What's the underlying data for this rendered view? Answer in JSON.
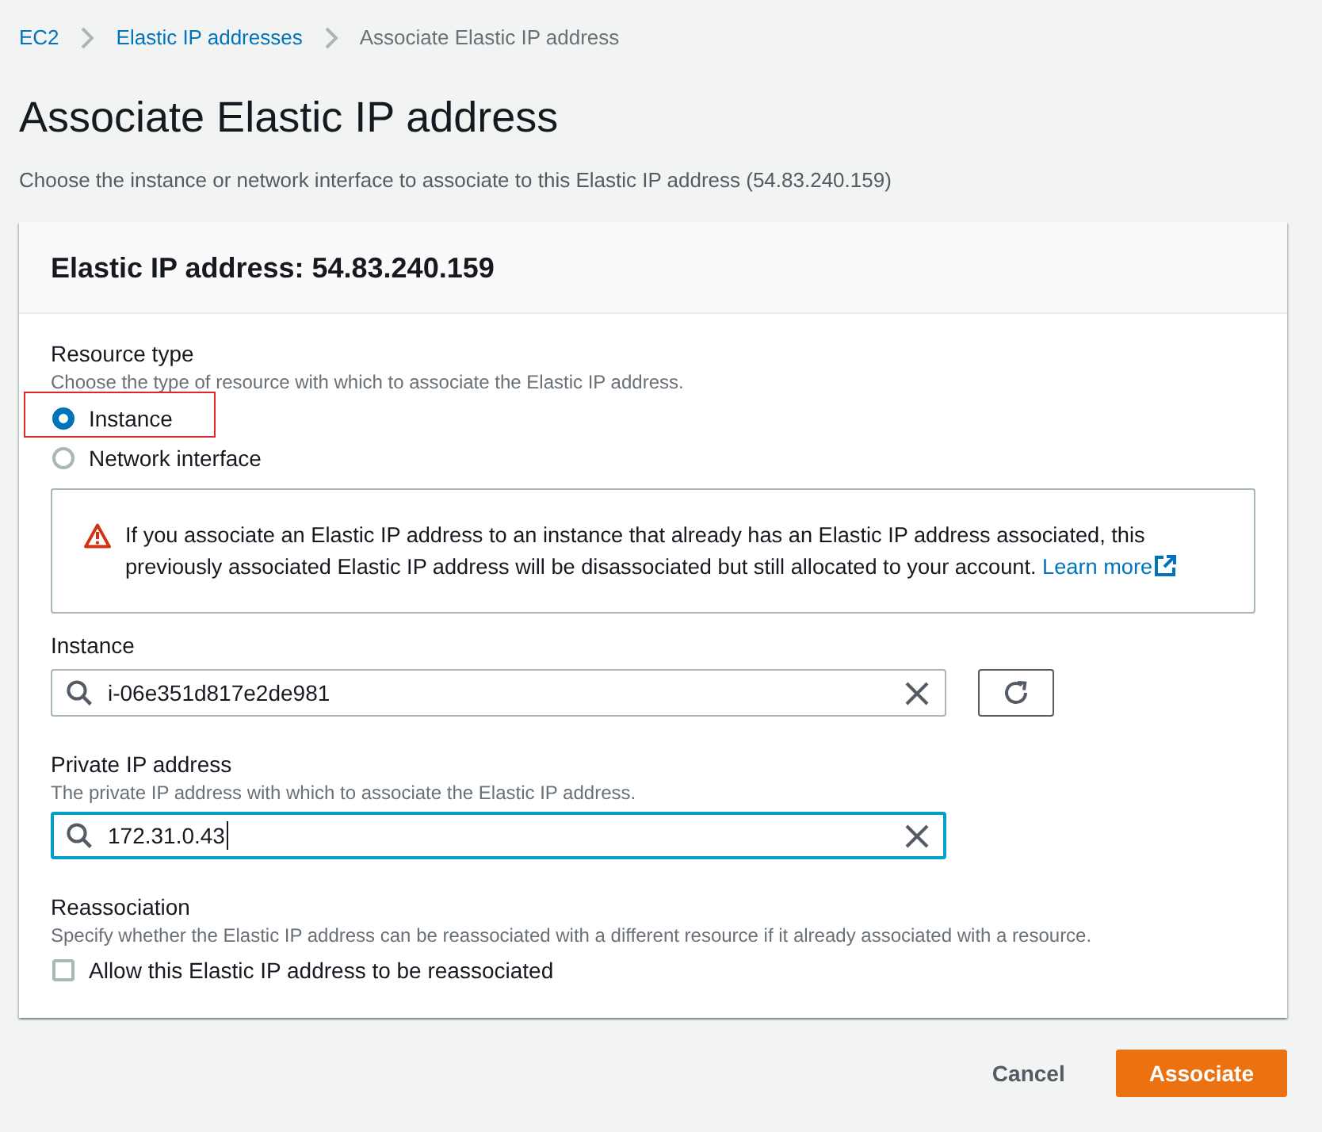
{
  "breadcrumbs": [
    {
      "label": "EC2",
      "kind": "link"
    },
    {
      "label": "Elastic IP addresses",
      "kind": "link"
    },
    {
      "label": "Associate Elastic IP address",
      "kind": "current"
    }
  ],
  "page": {
    "title": "Associate Elastic IP address",
    "description": "Choose the instance or network interface to associate to this Elastic IP address (54.83.240.159)"
  },
  "panel": {
    "title": "Elastic IP address: 54.83.240.159",
    "resource_type": {
      "label": "Resource type",
      "description": "Choose the type of resource with which to associate the Elastic IP address.",
      "options": [
        {
          "label": "Instance",
          "selected": true,
          "highlighted": true
        },
        {
          "label": "Network interface",
          "selected": false,
          "highlighted": false
        }
      ]
    },
    "alert": {
      "kind": "warning",
      "text": "If you associate an Elastic IP address to an instance that already has an Elastic IP address associated, this previously associated Elastic IP address will be disassociated but still allocated to your account.",
      "link": "Learn more"
    },
    "instance": {
      "label": "Instance",
      "value": "i-06e351d817e2de981",
      "focused": false
    },
    "private_ip": {
      "label": "Private IP address",
      "description": "The private IP address with which to associate the Elastic IP address.",
      "value": "172.31.0.43",
      "focused": true
    },
    "reassociation": {
      "label": "Reassociation",
      "description": "Specify whether the Elastic IP address can be reassociated with a different resource if it already associated with a resource.",
      "checkbox": {
        "label": "Allow this Elastic IP address to be reassociated",
        "checked": false
      }
    }
  },
  "buttons": [
    {
      "label": "Cancel",
      "kind": "link"
    },
    {
      "label": "Associate",
      "kind": "primary"
    }
  ]
}
